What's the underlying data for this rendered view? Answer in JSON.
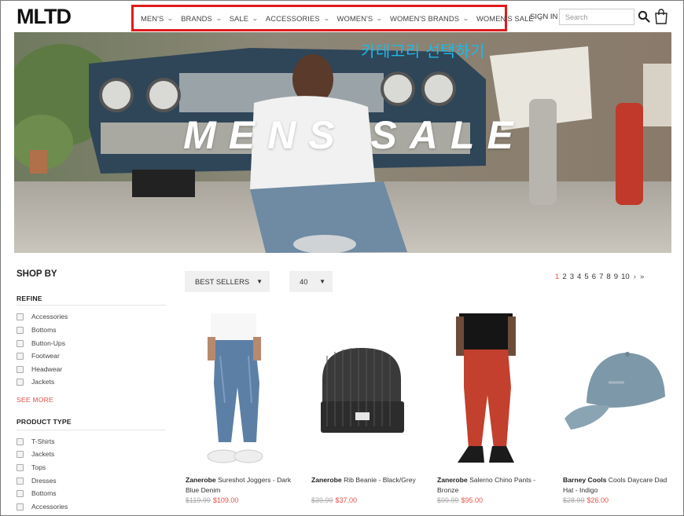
{
  "header": {
    "logo": "MLTD",
    "nav": [
      {
        "label": "MEN'S"
      },
      {
        "label": "BRANDS"
      },
      {
        "label": "SALE"
      },
      {
        "label": "ACCESSORIES"
      },
      {
        "label": "WOMEN'S"
      },
      {
        "label": "WOMEN'S BRANDS"
      },
      {
        "label": "WOMEN'S SALE"
      }
    ],
    "sign_in": "SIGN IN",
    "search_placeholder": "Search"
  },
  "hero": {
    "title": "MENS SALE",
    "annotation": "카테고리 선택하기"
  },
  "sidebar": {
    "heading": "SHOP BY",
    "refine": {
      "title": "REFINE",
      "options": [
        "Accessories",
        "Bottoms",
        "Button-Ups",
        "Footwear",
        "Headwear",
        "Jackets"
      ],
      "see_more": "SEE MORE"
    },
    "product_type": {
      "title": "PRODUCT TYPE",
      "options": [
        "T-Shirts",
        "Jackets",
        "Tops",
        "Dresses",
        "Bottoms",
        "Accessories"
      ]
    }
  },
  "toolbar": {
    "sort": "BEST SELLERS",
    "per_page": "40"
  },
  "pagination": {
    "pages": [
      "1",
      "2",
      "3",
      "4",
      "5",
      "6",
      "7",
      "8",
      "9",
      "10"
    ],
    "current": "1",
    "next": "›",
    "last": "»"
  },
  "products": [
    {
      "brand": "Zanerobe",
      "name": "Sureshot Joggers - Dark Blue Denim",
      "old_price": "$119.99",
      "price": "$109.00"
    },
    {
      "brand": "Zanerobe",
      "name": "Rib Beanie - Black/Grey",
      "old_price": "$39.99",
      "price": "$37.00"
    },
    {
      "brand": "Zanerobe",
      "name": "Salerno Chino Pants - Bronze",
      "old_price": "$99.99",
      "price": "$95.00"
    },
    {
      "brand": "Barney Cools",
      "name": "Cools Daycare Dad Hat - Indigo",
      "old_price": "$28.99",
      "price": "$26.00"
    }
  ],
  "colors": {
    "accent": "#e8524a",
    "nav_highlight": "#e01b1b",
    "annotation": "#1fb9e6"
  }
}
